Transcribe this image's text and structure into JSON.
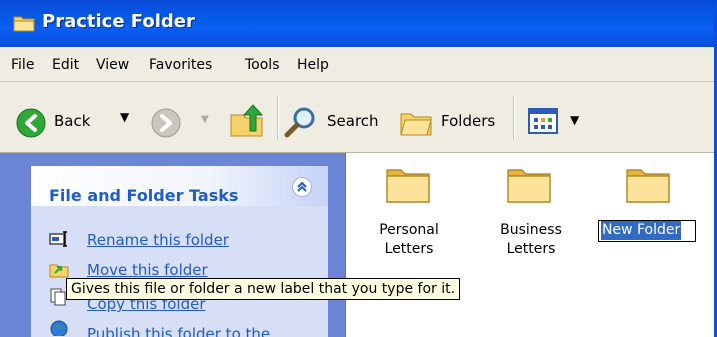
{
  "window": {
    "title": "Practice Folder"
  },
  "menu": {
    "items": [
      "File",
      "Edit",
      "View",
      "Favorites",
      "Tools",
      "Help"
    ]
  },
  "toolbar": {
    "back_label": "Back",
    "search_label": "Search",
    "folders_label": "Folders"
  },
  "tasks_panel": {
    "title": "File and Folder Tasks",
    "items": [
      "Rename this folder",
      "Move this folder",
      "Copy this folder",
      "Publish this folder to the"
    ]
  },
  "folders": [
    {
      "line1": "Personal",
      "line2": "Letters"
    },
    {
      "line1": "Business",
      "line2": "Letters"
    }
  ],
  "rename": {
    "value": "New Folder"
  },
  "tooltip": {
    "text": "Gives this file or folder a new label that you type for it."
  },
  "colors": {
    "titlebar": "#0a50e0",
    "task_link": "#215dc6",
    "selection": "#316ac5",
    "tooltip_bg": "#ffffe1"
  }
}
